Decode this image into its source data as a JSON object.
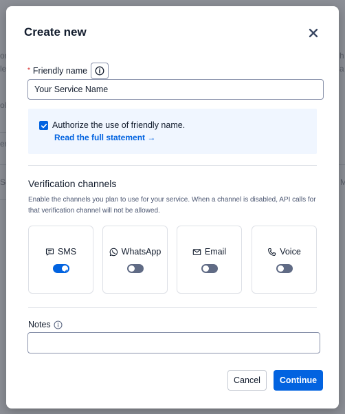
{
  "background": {
    "fragments_left": [
      "on",
      "le",
      "ol",
      "er",
      "Se"
    ],
    "fragments_right": [
      "h",
      "a",
      "M"
    ]
  },
  "modal": {
    "title": "Create new",
    "close_icon": "close-icon"
  },
  "friendly_name": {
    "required_marker": "*",
    "label": "Friendly name",
    "value": "Your Service Name"
  },
  "consent": {
    "checked": true,
    "text": "Authorize the use of friendly name.",
    "link": "Read the full statement →"
  },
  "verification": {
    "title": "Verification channels",
    "description": "Enable the channels you plan to use for your service. When a channel is disabled, API calls for that verification channel will not be allowed.",
    "channels": [
      {
        "label": "SMS",
        "icon": "message-icon",
        "enabled": true
      },
      {
        "label": "WhatsApp",
        "icon": "whatsapp-icon",
        "enabled": false
      },
      {
        "label": "Email",
        "icon": "email-icon",
        "enabled": false
      },
      {
        "label": "Voice",
        "icon": "phone-icon",
        "enabled": false
      }
    ]
  },
  "notes": {
    "label": "Notes",
    "value": ""
  },
  "actions": {
    "cancel": "Cancel",
    "continue": "Continue"
  },
  "colors": {
    "primary": "#0263e0",
    "text": "#121c2d",
    "scrim": "#8c8f96",
    "consent_bg": "#f0f6ff",
    "required": "#d61f1f"
  }
}
